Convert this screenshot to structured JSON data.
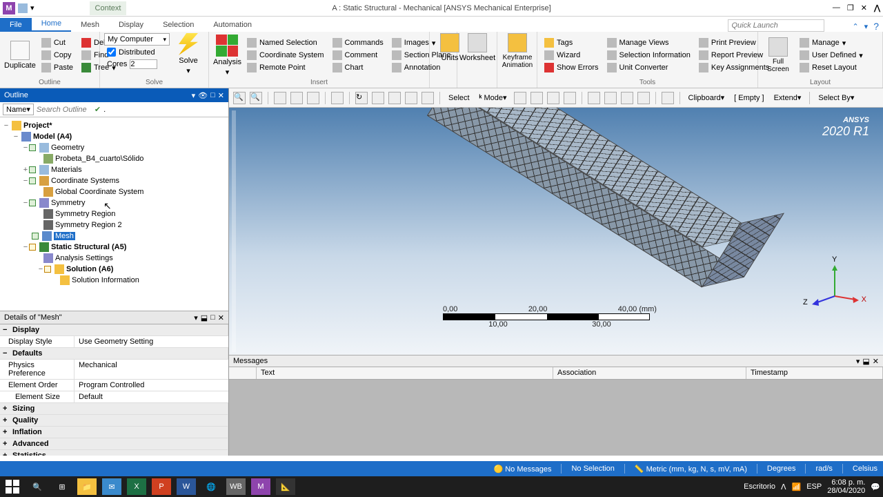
{
  "titlebar": {
    "context": "Context",
    "title": "A : Static Structural - Mechanical [ANSYS Mechanical Enterprise]"
  },
  "ribbonTabs": {
    "file": "File",
    "tabs": [
      "Home",
      "Mesh",
      "Display",
      "Selection",
      "Automation"
    ],
    "quickLaunchPlaceholder": "Quick Launch"
  },
  "ribbon": {
    "outline": {
      "duplicate": "Duplicate",
      "cut": "Cut",
      "copy": "Copy",
      "paste": "Paste",
      "delete": "Delete",
      "find": "Find",
      "tree": "Tree",
      "label": "Outline"
    },
    "solve": {
      "computer": "My Computer",
      "distributed": "Distributed",
      "coresLabel": "Cores",
      "coresValue": "2",
      "solve": "Solve",
      "label": "Solve"
    },
    "insert": {
      "analysis": "Analysis",
      "namedSel": "Named Selection",
      "coordSys": "Coordinate System",
      "remotePoint": "Remote Point",
      "commands": "Commands",
      "comment": "Comment",
      "chart": "Chart",
      "images": "Images",
      "sectionPlane": "Section Plane",
      "annotation": "Annotation",
      "label": "Insert"
    },
    "units": "Units",
    "worksheet": "Worksheet",
    "keyframe": "Keyframe\nAnimation",
    "tools": {
      "tags": "Tags",
      "wizard": "Wizard",
      "showErrors": "Show Errors",
      "manageViews": "Manage Views",
      "selectionInfo": "Selection Information",
      "unitConverter": "Unit Converter",
      "printPreview": "Print Preview",
      "reportPreview": "Report Preview",
      "keyAssign": "Key Assignments",
      "label": "Tools"
    },
    "layout": {
      "fullScreen": "Full\nScreen",
      "manage": "Manage",
      "userDefined": "User Defined",
      "resetLayout": "Reset Layout",
      "label": "Layout"
    }
  },
  "outline": {
    "header": "Outline",
    "nameLabel": "Name",
    "searchPlaceholder": "Search Outline"
  },
  "tree": {
    "project": "Project*",
    "model": "Model (A4)",
    "geometry": "Geometry",
    "geomChild": "Probeta_B4_cuarto\\Sólido",
    "materials": "Materials",
    "coordSys": "Coordinate Systems",
    "globalCS": "Global Coordinate System",
    "symmetry": "Symmetry",
    "symR1": "Symmetry Region",
    "symR2": "Symmetry Region 2",
    "mesh": "Mesh",
    "staticStruct": "Static Structural (A5)",
    "analysisSettings": "Analysis Settings",
    "solution": "Solution (A6)",
    "solInfo": "Solution Information"
  },
  "details": {
    "header": "Details of \"Mesh\"",
    "cats": {
      "display": "Display",
      "defaults": "Defaults",
      "sizing": "Sizing",
      "quality": "Quality",
      "inflation": "Inflation",
      "advanced": "Advanced",
      "statistics": "Statistics"
    },
    "rows": {
      "displayStyle": {
        "k": "Display Style",
        "v": "Use Geometry Setting"
      },
      "physicsPref": {
        "k": "Physics Preference",
        "v": "Mechanical"
      },
      "elemOrder": {
        "k": "Element Order",
        "v": "Program Controlled"
      },
      "elemSize": {
        "k": "Element Size",
        "v": "Default"
      }
    }
  },
  "viewportToolbar": {
    "select": "Select",
    "mode": "Mode",
    "clipboard": "Clipboard",
    "empty": "[ Empty ]",
    "extend": "Extend",
    "selectBy": "Select By"
  },
  "ansys": {
    "brand": "ANSYS",
    "version": "2020 R1"
  },
  "scale": {
    "top": [
      "0,00",
      "20,00",
      "40,00 (mm)"
    ],
    "bottom": [
      "10,00",
      "30,00"
    ]
  },
  "triad": {
    "x": "X",
    "y": "Y",
    "z": "Z"
  },
  "messages": {
    "header": "Messages",
    "cols": {
      "text": "Text",
      "assoc": "Association",
      "ts": "Timestamp"
    }
  },
  "status": {
    "noMessages": "No Messages",
    "noSelection": "No Selection",
    "metric": "Metric (mm, kg, N, s, mV, mA)",
    "degrees": "Degrees",
    "rads": "rad/s",
    "celsius": "Celsius"
  },
  "systray": {
    "escritorio": "Escritorio",
    "lang": "ESP",
    "time": "6:08 p. m.",
    "date": "28/04/2020"
  }
}
